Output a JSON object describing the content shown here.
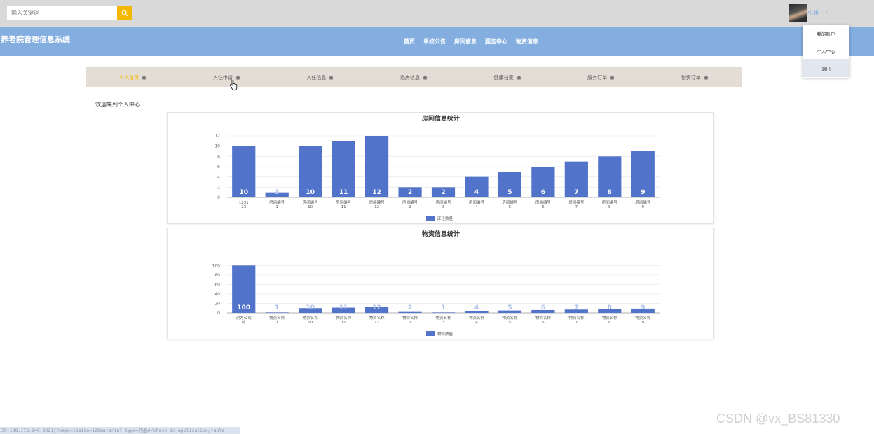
{
  "search": {
    "placeholder": "输入关键词"
  },
  "user": {
    "name": "小张",
    "caret": "⌄"
  },
  "brand": {
    "title": "养老院管理信息系统"
  },
  "mainnav": [
    "首页",
    "系统公告",
    "房间信息",
    "服务中心",
    "物资信息"
  ],
  "user_menu": [
    "我的账户",
    "个人中心",
    "退出"
  ],
  "subnav": [
    "个人首页",
    "入住申请",
    "入住信息",
    "退房信息",
    "健康档案",
    "服务订单",
    "物资订单"
  ],
  "welcome": "欢迎来到个人中心",
  "colors": {
    "accent": "#f5b800",
    "header": "#84aee0",
    "bar": "#5173c9",
    "topbar": "#d9d9d9"
  },
  "chart_data": [
    {
      "type": "bar",
      "title": "房间信息统计",
      "categories": [
        [
          "1231",
          "23"
        ],
        [
          "房间编号",
          "1"
        ],
        [
          "房间编号",
          "10"
        ],
        [
          "房间编号",
          "11"
        ],
        [
          "房间编号",
          "12"
        ],
        [
          "房间编号",
          "2"
        ],
        [
          "房间编号",
          "3"
        ],
        [
          "房间编号",
          "4"
        ],
        [
          "房间编号",
          "5"
        ],
        [
          "房间编号",
          "6"
        ],
        [
          "房间编号",
          "7"
        ],
        [
          "房间编号",
          "8"
        ],
        [
          "房间编号",
          "9"
        ]
      ],
      "series": [
        {
          "name": "床位数量",
          "values": [
            10,
            1,
            10,
            11,
            12,
            2,
            2,
            4,
            5,
            6,
            7,
            8,
            9
          ]
        }
      ],
      "yticks": [
        0,
        2,
        4,
        6,
        8,
        10,
        12
      ],
      "ylim": [
        0,
        12
      ],
      "grid": true,
      "legend": "bottom"
    },
    {
      "type": "bar",
      "title": "物资信息统计",
      "categories": [
        [
          "对方公司",
          "的"
        ],
        [
          "物资名称",
          "1"
        ],
        [
          "物资名称",
          "10"
        ],
        [
          "物资名称",
          "11"
        ],
        [
          "物资名称",
          "12"
        ],
        [
          "物资名称",
          "2"
        ],
        [
          "物资名称",
          "3"
        ],
        [
          "物资名称",
          "4"
        ],
        [
          "物资名称",
          "5"
        ],
        [
          "物资名称",
          "6"
        ],
        [
          "物资名称",
          "7"
        ],
        [
          "物资名称",
          "8"
        ],
        [
          "物资名称",
          "9"
        ]
      ],
      "series": [
        {
          "name": "物资数量",
          "values": [
            100,
            1,
            10,
            11,
            12,
            2,
            1,
            4,
            5,
            6,
            7,
            8,
            9
          ]
        }
      ],
      "yticks": [
        0,
        20,
        40,
        60,
        80,
        100
      ],
      "ylim": [
        0,
        130
      ],
      "grid": true,
      "legend": "bottom"
    }
  ],
  "statusbar": "39.108.173.140:8021/?page=1&size=12&material_type=药品#/check_in_application/table",
  "watermark": "CSDN @vx_BS81330"
}
